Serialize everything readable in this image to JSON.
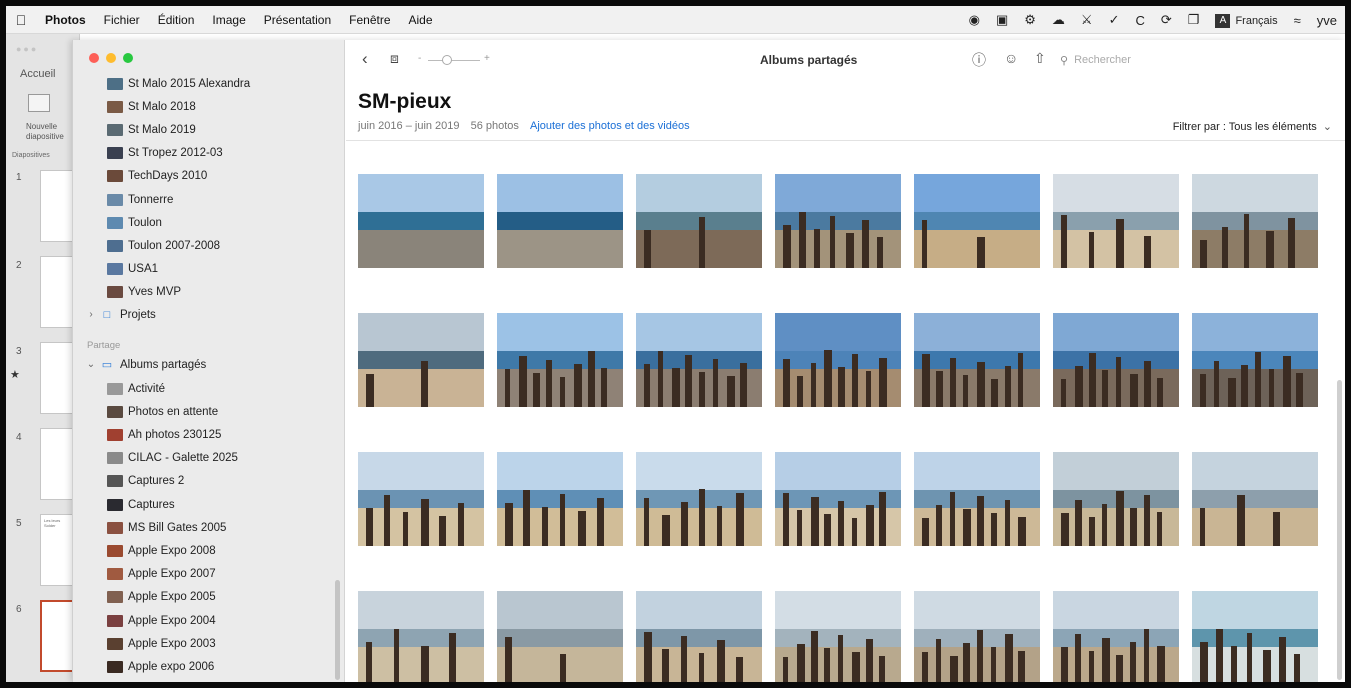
{
  "menubar": {
    "items": [
      "Photos",
      "Fichier",
      "Édition",
      "Image",
      "Présentation",
      "Fenêtre",
      "Aide"
    ],
    "language_badge": "A",
    "language": "Français",
    "user_fragment": "yve"
  },
  "keynote": {
    "home_label": "Accueil",
    "new_slide_label": "Nouvelle diapositive",
    "slides_label": "Diapositives",
    "slide_numbers": [
      "1",
      "2",
      "3",
      "4",
      "5",
      "6"
    ],
    "slide5_text": "Les leurs Solder"
  },
  "sidebar": {
    "albums": [
      {
        "label": "St Malo 2015 Alexandra",
        "color": "#4d6f86"
      },
      {
        "label": "St Malo 2018",
        "color": "#7a5a45"
      },
      {
        "label": "St Malo 2019",
        "color": "#5a6a72"
      },
      {
        "label": "St Tropez 2012-03",
        "color": "#3a4050"
      },
      {
        "label": "TechDays 2010",
        "color": "#6b4a3a"
      },
      {
        "label": "Tonnerre",
        "color": "#6a8aa8"
      },
      {
        "label": "Toulon",
        "color": "#5e8ab0"
      },
      {
        "label": "Toulon 2007-2008",
        "color": "#4e6e90"
      },
      {
        "label": "USA1",
        "color": "#5a78a0"
      },
      {
        "label": "Yves MVP",
        "color": "#6a4a40"
      }
    ],
    "projects_label": "Projets",
    "section_label": "Partage",
    "shared_albums_label": "Albums partagés",
    "shared": [
      {
        "label": "Activité",
        "color": "#999999"
      },
      {
        "label": "Photos en attente",
        "color": "#5a4a40"
      },
      {
        "label": "Ah photos 230125",
        "color": "#a04030"
      },
      {
        "label": "CILAC - Galette 2025",
        "color": "#8a8a8a"
      },
      {
        "label": "Captures 2",
        "color": "#555555"
      },
      {
        "label": "Captures",
        "color": "#2a2a30"
      },
      {
        "label": "MS Bill Gates 2005",
        "color": "#8a5040"
      },
      {
        "label": "Apple Expo 2008",
        "color": "#9a4a30"
      },
      {
        "label": "Apple Expo 2007",
        "color": "#a05a40"
      },
      {
        "label": "Apple Expo 2005",
        "color": "#806050"
      },
      {
        "label": "Apple Expo 2004",
        "color": "#7a4040"
      },
      {
        "label": "Apple Expo 2003",
        "color": "#5a4030"
      },
      {
        "label": "Apple expo 2006",
        "color": "#3a2a22"
      }
    ]
  },
  "toolbar": {
    "title": "Albums partagés",
    "search_placeholder": "Rechercher"
  },
  "album": {
    "title": "SM-pieux",
    "date_range": "juin 2016 – juin 2019",
    "count": "56 photos",
    "add_link": "Ajouter des photos et des vidéos",
    "filter_label": "Filtrer par : Tous les éléments"
  },
  "photos": [
    {
      "sky": "#a9c8e6",
      "sea": "#2f6f95",
      "sand": "#8a847a",
      "posts": 0
    },
    {
      "sky": "#9cc0e4",
      "sea": "#245d86",
      "sand": "#9c9486",
      "posts": 0
    },
    {
      "sky": "#b4cde0",
      "sea": "#5a7f8e",
      "sand": "#7d6a58",
      "posts": 2
    },
    {
      "sky": "#7fa9d8",
      "sea": "#4b7aa0",
      "sand": "#a3937a",
      "posts": 7
    },
    {
      "sky": "#76a6dc",
      "sea": "#4f86b2",
      "sand": "#c6ad86",
      "posts": 2
    },
    {
      "sky": "#d6dde4",
      "sea": "#8aa0ad",
      "sand": "#d3c2a4",
      "posts": 4
    },
    {
      "sky": "#cdd8e0",
      "sea": "#7f93a0",
      "sand": "#8d7c66",
      "posts": 5
    },
    {
      "sky": "#b8c6d2",
      "sea": "#4f6b7e",
      "sand": "#c9b395",
      "posts": 2
    },
    {
      "sky": "#9cc2e6",
      "sea": "#3f79a8",
      "sand": "#8f8276",
      "posts": 8
    },
    {
      "sky": "#a6c6e4",
      "sea": "#3a6f9e",
      "sand": "#8b7d70",
      "posts": 8
    },
    {
      "sky": "#5f8fc4",
      "sea": "#4d83b8",
      "sand": "#a58c70",
      "posts": 8
    },
    {
      "sky": "#8cb0d8",
      "sea": "#3d78ad",
      "sand": "#8a7a6a",
      "posts": 8
    },
    {
      "sky": "#7fa8d4",
      "sea": "#3c72a6",
      "sand": "#7a6a5c",
      "posts": 8
    },
    {
      "sky": "#8cb2da",
      "sea": "#4b86bb",
      "sand": "#6d6258",
      "posts": 8
    },
    {
      "sky": "#c7d8e8",
      "sea": "#6b93b3",
      "sand": "#d4c3a2",
      "posts": 6
    },
    {
      "sky": "#bcd4ea",
      "sea": "#5f8fb6",
      "sand": "#d1bd98",
      "posts": 6
    },
    {
      "sky": "#c9dbeb",
      "sea": "#6f97b5",
      "sand": "#cfbb96",
      "posts": 6
    },
    {
      "sky": "#b6cee6",
      "sea": "#6d96b6",
      "sand": "#d6c6a8",
      "posts": 8
    },
    {
      "sky": "#bed3e8",
      "sea": "#6e94b0",
      "sand": "#cdb997",
      "posts": 8
    },
    {
      "sky": "#c2cfd8",
      "sea": "#7d93a0",
      "sand": "#c8b898",
      "posts": 8
    },
    {
      "sky": "#c5d3de",
      "sea": "#8d9fac",
      "sand": "#c9b594",
      "posts": 3
    },
    {
      "sky": "#c8d3dc",
      "sea": "#8ea4b2",
      "sand": "#cdbfa3",
      "posts": 4
    },
    {
      "sky": "#b9c6d0",
      "sea": "#8a9aa4",
      "sand": "#c5b69a",
      "posts": 2
    },
    {
      "sky": "#c2d2df",
      "sea": "#7e97a8",
      "sand": "#c8b596",
      "posts": 6
    },
    {
      "sky": "#d3dde5",
      "sea": "#a3b3bd",
      "sand": "#b8a98e",
      "posts": 8
    },
    {
      "sky": "#cfdae3",
      "sea": "#9fb0bc",
      "sand": "#b3a288",
      "posts": 8
    },
    {
      "sky": "#c9d6e1",
      "sea": "#8ca5b6",
      "sand": "#bba88b",
      "posts": 8
    },
    {
      "sky": "#bfd6e2",
      "sea": "#5e95ac",
      "sand": "#d7dfe0",
      "posts": 7
    }
  ]
}
